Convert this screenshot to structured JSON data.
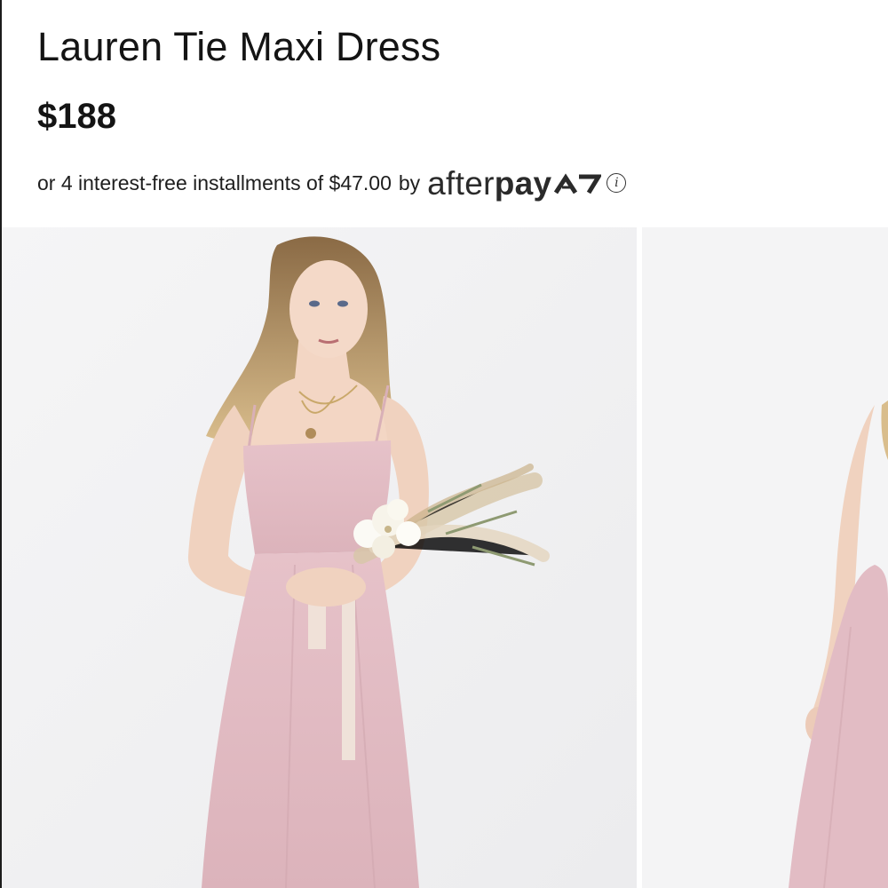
{
  "product": {
    "title": "Lauren Tie Maxi Dress",
    "price": "$188"
  },
  "payment": {
    "installment_text": "or 4 interest-free installments of $47.00",
    "by_text": "by",
    "provider_part1": "after",
    "provider_part2": "pay",
    "provider_icon": "afterpay-arrows-icon",
    "info_icon": "info-icon"
  },
  "gallery": {
    "images": [
      {
        "name": "model-front-photo",
        "dress_color": "#e3bcc3"
      },
      {
        "name": "model-side-photo",
        "dress_color": "#e3bcc3"
      }
    ]
  },
  "colors": {
    "dress_pink": "#e3bcc3",
    "background": "#f2f2f3",
    "text": "#141414"
  }
}
